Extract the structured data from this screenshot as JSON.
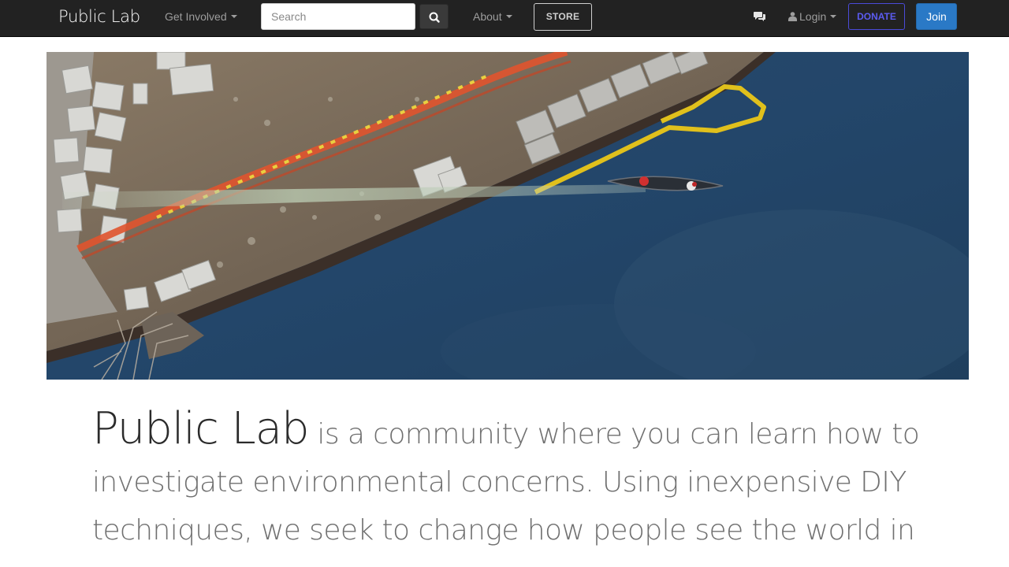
{
  "navbar": {
    "brand": "Public Lab",
    "get_involved": "Get Involved",
    "search_placeholder": "Search",
    "about": "About",
    "store": "STORE",
    "login": "Login",
    "donate": "DONATE",
    "join": "Join"
  },
  "icons": {
    "search": "search-icon",
    "chat": "comments-icon",
    "user": "user-icon"
  },
  "hero": {
    "description": "aerial-photo-river-boat"
  },
  "intro": {
    "lab_name": "Public Lab",
    "text": " is a community where you can learn how to investigate environmental concerns. Using inexpensive DIY techniques, we seek to change how people see the world in"
  },
  "colors": {
    "navbar_bg": "#222222",
    "donate": "#5b5bf0",
    "join_bg": "#2a79c6",
    "intro_text": "#707070",
    "lab_name": "#2b2b2b"
  }
}
